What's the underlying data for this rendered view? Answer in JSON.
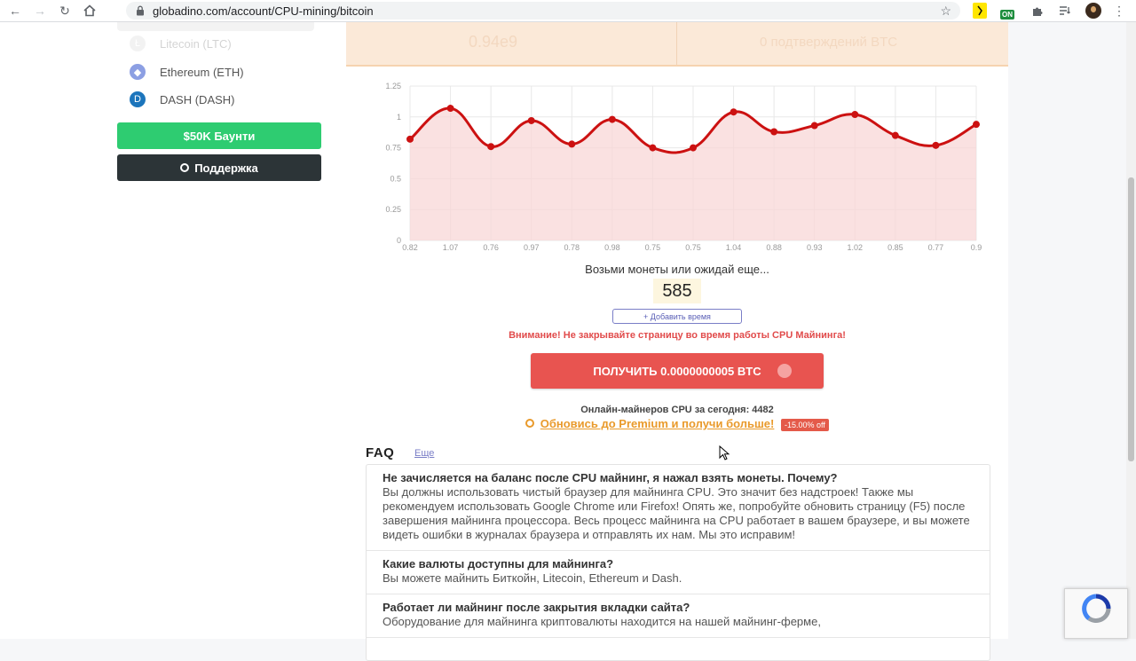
{
  "browser": {
    "url": "globadino.com/account/CPU-mining/bitcoin",
    "ext_on_label": "ON"
  },
  "sidebar": {
    "coins": [
      {
        "label": "Litecoin (LTC)",
        "color": "#cfcfcf"
      },
      {
        "label": "Ethereum (ETH)",
        "color": "#8c9fe3"
      },
      {
        "label": "DASH (DASH)",
        "color": "#1c75bc"
      }
    ],
    "bounty_button": "$50K Баунти",
    "support_button": "Поддержка"
  },
  "top_strip": {
    "left_value": "0.94e9",
    "right_value": "0 подтверждений BTC"
  },
  "chart_data": {
    "type": "area",
    "x": [
      "0.82",
      "1.07",
      "0.76",
      "0.97",
      "0.78",
      "0.98",
      "0.75",
      "0.75",
      "1.04",
      "0.88",
      "0.93",
      "1.02",
      "0.85",
      "0.77",
      "0.9"
    ],
    "values": [
      0.82,
      1.07,
      0.76,
      0.97,
      0.78,
      0.98,
      0.75,
      0.75,
      1.04,
      0.88,
      0.93,
      1.02,
      0.85,
      0.77,
      0.94
    ],
    "y_ticks": [
      "0",
      "0.25",
      "0.5",
      "0.75",
      "1",
      "1.25"
    ],
    "ylim": [
      0,
      1.25
    ],
    "grid": true,
    "line_color": "#cc1111",
    "fill_color": "#f8d7d7"
  },
  "main": {
    "prompt_text": "Возьми монеты или ожидай еще...",
    "timer": "585",
    "add_time_label": "+ Добавить время",
    "warning": "Внимание! Не закрывайте страницу во время работы CPU Майнинга!",
    "claim_button": "ПОЛУЧИТЬ 0.0000000005 BTC",
    "online_miners": "Онлайн-майнеров CPU за сегодня: 4482",
    "premium_link": "Обновись до Premium и получи больше!",
    "premium_badge": "-15.00% off"
  },
  "faq": {
    "title": "FAQ",
    "more_link": "Еще",
    "items": [
      {
        "q": "Не зачисляется на баланс после CPU майнинг, я нажал взять монеты. Почему?",
        "a": "Вы должны использовать чистый браузер для майнинга CPU. Это значит без надстроек! Также мы рекомендуем использовать Google Chrome или Firefox! Опять же, попробуйте обновить страницу (F5) после завершения майнинга процессора. Весь процесс майнинга на CPU работает в вашем браузере, и вы можете видеть ошибки в журналах браузера и отправлять их нам. Мы это исправим!"
      },
      {
        "q": "Какие валюты доступны для майнинга?",
        "a": "Вы можете майнить Биткойн, Litecoin, Ethereum и Dash."
      },
      {
        "q": "Работает ли майнинг после закрытия вкладки сайта?",
        "a": "Оборудование для майнинга криптовалюты находится на нашей майнинг-ферме,"
      }
    ]
  }
}
